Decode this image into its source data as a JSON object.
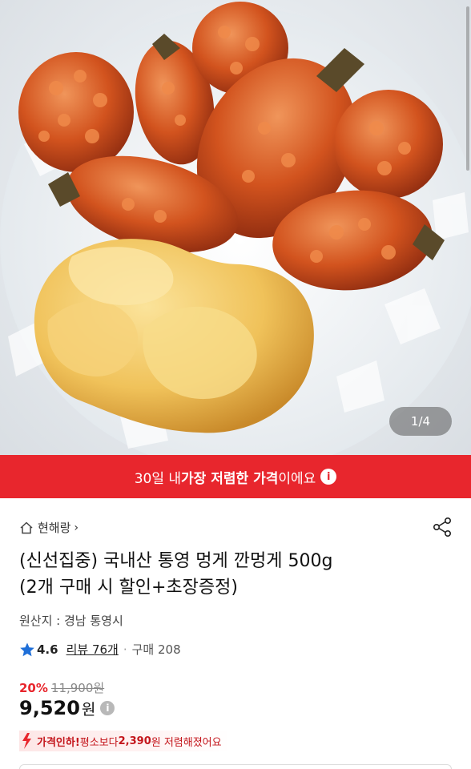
{
  "gallery": {
    "counter": "1/4"
  },
  "banner": {
    "prefix": "30일 내 ",
    "highlight": "가장 저렴한 가격",
    "suffix": "이에요",
    "info_glyph": "i"
  },
  "store": {
    "name": "현해랑",
    "chevron": "›",
    "icon": "home-icon"
  },
  "product": {
    "title_line1": "(신선집중) 국내산 통영 멍게 깐멍게 500g",
    "title_line2": "(2개 구매 시 할인+초장증정)",
    "origin": "원산지 : 경남 통영시"
  },
  "rating": {
    "score": "4.6",
    "reviews": "리뷰 76개",
    "separator": "·",
    "purchases": "구매 208"
  },
  "pricing": {
    "discount_pct": "20%",
    "original_price": "11,900원",
    "price": "9,520",
    "price_unit": "원",
    "info_glyph": "i"
  },
  "price_drop": {
    "label": "가격인하!",
    "middle": " 평소보다 ",
    "amount": "2,390",
    "suffix": "원 저렴해졌어요"
  },
  "colors": {
    "accent_red": "#e8262d",
    "star_blue": "#1f6fd8"
  }
}
